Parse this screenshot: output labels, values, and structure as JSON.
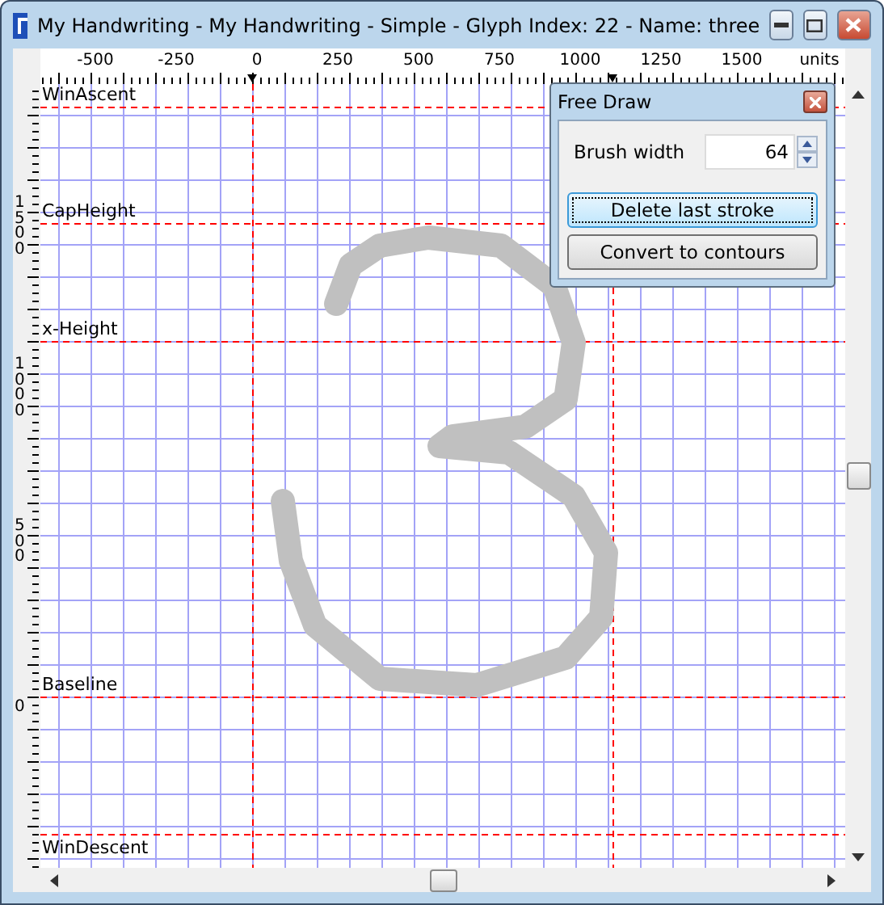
{
  "window": {
    "title": "My Handwriting - My Handwriting - Simple - Glyph Index: 22 - Name: three"
  },
  "ruler": {
    "labels": [
      "-500",
      "-250",
      "0",
      "250",
      "500",
      "750",
      "1000",
      "1250",
      "1500"
    ],
    "unit": "units"
  },
  "side_ruler": {
    "labels": [
      "1500",
      "1000",
      "500",
      "0"
    ]
  },
  "metric_lines": [
    {
      "label": "WinAscent"
    },
    {
      "label": "CapHeight"
    },
    {
      "label": "x-Height"
    },
    {
      "label": "Baseline"
    },
    {
      "label": "WinDescent"
    }
  ],
  "free_draw": {
    "title": "Free Draw",
    "brush_width": {
      "label": "Brush width",
      "value": "64"
    },
    "buttons": [
      {
        "label": "Delete last stroke",
        "focused": true
      },
      {
        "label": "Convert to contours",
        "focused": false
      }
    ]
  }
}
